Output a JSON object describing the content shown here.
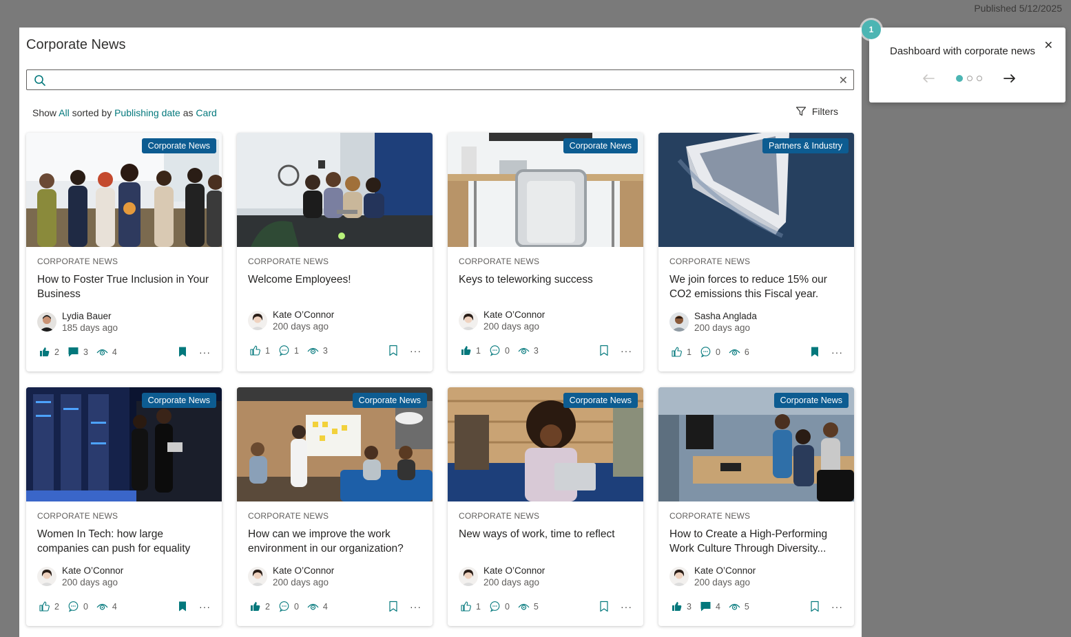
{
  "published": "Published 5/12/2025",
  "panel": {
    "title": "Corporate News"
  },
  "search": {
    "placeholder": "",
    "clear_icon": "close-icon"
  },
  "show": {
    "prefix": "Show",
    "filter": "All",
    "sorted_by": "sorted by",
    "sort": "Publishing date",
    "as": "as",
    "view": "Card"
  },
  "filters_label": "Filters",
  "accent": "#03787c",
  "badge_color": "#0d5c91",
  "cards": [
    {
      "badge": "Corporate News",
      "category": "CORPORATE NEWS",
      "title": "How to Foster True Inclusion in Your Business",
      "author": "Lydia Bauer",
      "date": "185 days ago",
      "likes": "2",
      "comments": "3",
      "views": "4",
      "liked": true,
      "commented": true,
      "saved": true,
      "scene": "celebration"
    },
    {
      "badge": "",
      "category": "CORPORATE NEWS",
      "title": "Welcome Employees!",
      "author": "Kate O’Connor",
      "date": "200 days ago",
      "likes": "1",
      "comments": "1",
      "views": "3",
      "liked": false,
      "commented": false,
      "saved": false,
      "scene": "meeting"
    },
    {
      "badge": "Corporate News",
      "category": "CORPORATE NEWS",
      "title": "Keys to teleworking success",
      "author": "Kate O’Connor",
      "date": "200 days ago",
      "likes": "1",
      "comments": "0",
      "views": "3",
      "liked": true,
      "commented": false,
      "saved": false,
      "scene": "desk"
    },
    {
      "badge": "Partners & Industry",
      "category": "CORPORATE NEWS",
      "title": "We join forces to reduce 15% our CO2 emissions this Fiscal year.",
      "author": "Sasha Anglada",
      "date": "200 days ago",
      "likes": "1",
      "comments": "0",
      "views": "6",
      "liked": false,
      "commented": false,
      "saved": true,
      "scene": "ship"
    },
    {
      "badge": "Corporate News",
      "category": "CORPORATE NEWS",
      "title": "Women In Tech: how large companies can push for equality",
      "author": "Kate O’Connor",
      "date": "200 days ago",
      "likes": "2",
      "comments": "0",
      "views": "4",
      "liked": false,
      "commented": false,
      "saved": true,
      "scene": "datacenter"
    },
    {
      "badge": "Corporate News",
      "category": "CORPORATE NEWS",
      "title": "How can we improve the work environment in our organization?",
      "author": "Kate O’Connor",
      "date": "200 days ago",
      "likes": "2",
      "comments": "0",
      "views": "4",
      "liked": true,
      "commented": false,
      "saved": false,
      "scene": "office"
    },
    {
      "badge": "Corporate News",
      "category": "CORPORATE NEWS",
      "title": "New ways of work, time to reflect",
      "author": "Kate O’Connor",
      "date": "200 days ago",
      "likes": "1",
      "comments": "0",
      "views": "5",
      "liked": false,
      "commented": false,
      "saved": false,
      "scene": "laptop"
    },
    {
      "badge": "Corporate News",
      "category": "CORPORATE NEWS",
      "title": "How to Create a High-Performing Work Culture Through Diversity...",
      "author": "Kate O’Connor",
      "date": "200 days ago",
      "likes": "3",
      "comments": "4",
      "views": "5",
      "liked": true,
      "commented": true,
      "saved": false,
      "scene": "openoffice"
    }
  ],
  "tour": {
    "step": "1",
    "text": "Dashboard with corporate news",
    "total_steps": 3,
    "current_step": 1
  }
}
